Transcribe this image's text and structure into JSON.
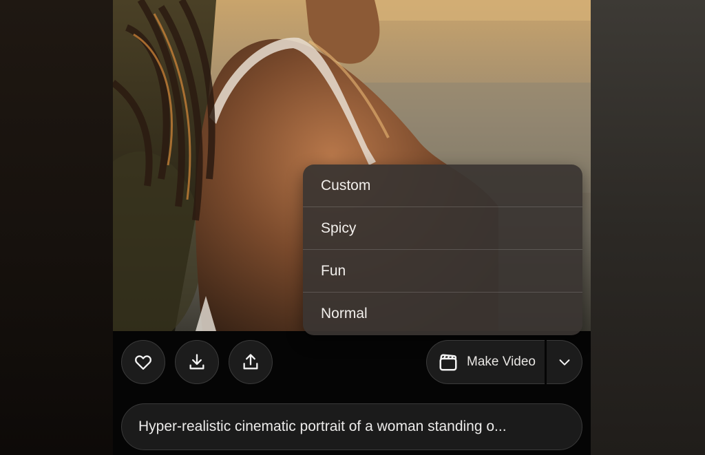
{
  "image": {
    "subject": "photo-portrait",
    "colors": {
      "sky": "#b98f5c",
      "skin": "#7a4a2c",
      "hair": "#2a1a10",
      "sea": "#8a8270"
    }
  },
  "menu": {
    "items": [
      {
        "label": "Custom"
      },
      {
        "label": "Spicy"
      },
      {
        "label": "Fun"
      },
      {
        "label": "Normal"
      }
    ]
  },
  "actions": {
    "like_icon": "heart-icon",
    "download_icon": "download-icon",
    "share_icon": "share-icon",
    "make_video_label": "Make Video",
    "make_video_icon": "clapperboard-icon",
    "dropdown_icon": "chevron-down-icon"
  },
  "prompt": {
    "text": "Hyper-realistic cinematic portrait of a woman standing o..."
  },
  "colors": {
    "background": "#050505",
    "button_bg": "#1c1c1c",
    "button_border": "#3b3b3b",
    "menu_bg": "#3a3531",
    "text": "#f2efec"
  }
}
